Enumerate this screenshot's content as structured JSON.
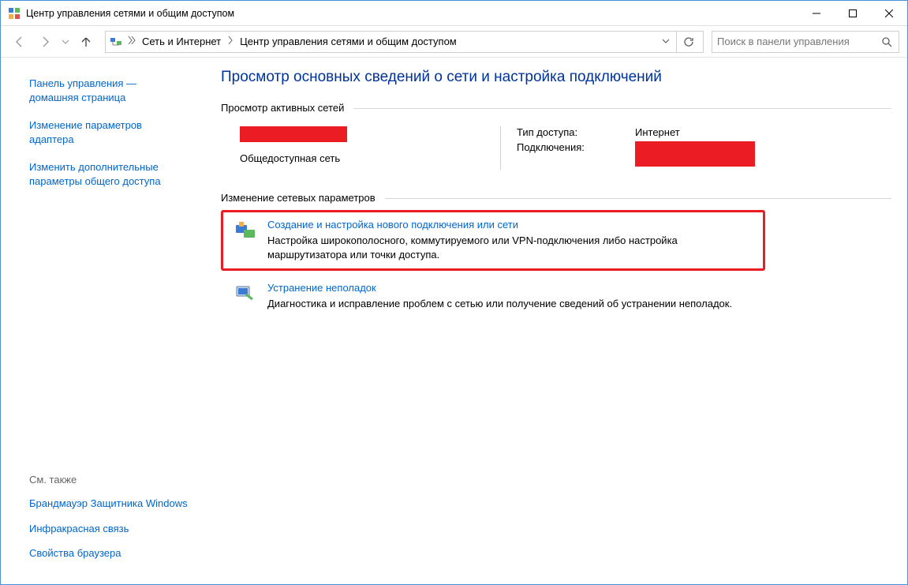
{
  "window": {
    "title": "Центр управления сетями и общим доступом"
  },
  "breadcrumb": {
    "segments": [
      "Сеть и Интернет",
      "Центр управления сетями и общим доступом"
    ]
  },
  "search": {
    "placeholder": "Поиск в панели управления"
  },
  "sidebar": {
    "links": [
      "Панель управления — домашняя страница",
      "Изменение параметров адаптера",
      "Изменить дополнительные параметры общего доступа"
    ],
    "see_also_label": "См. также",
    "footer_links": [
      "Брандмауэр Защитника Windows",
      "Инфракрасная связь",
      "Свойства браузера"
    ]
  },
  "main": {
    "heading": "Просмотр основных сведений о сети и настройка подключений",
    "active_networks_title": "Просмотр активных сетей",
    "network": {
      "type_sub": "Общедоступная сеть",
      "access_type_label": "Тип доступа:",
      "access_type_value": "Интернет",
      "connections_label": "Подключения:"
    },
    "change_settings_title": "Изменение сетевых параметров",
    "options": [
      {
        "link": "Создание и настройка нового подключения или сети",
        "desc": "Настройка широкополосного, коммутируемого или VPN-подключения либо настройка маршрутизатора или точки доступа."
      },
      {
        "link": "Устранение неполадок",
        "desc": "Диагностика и исправление проблем с сетью или получение сведений об устранении неполадок."
      }
    ]
  }
}
